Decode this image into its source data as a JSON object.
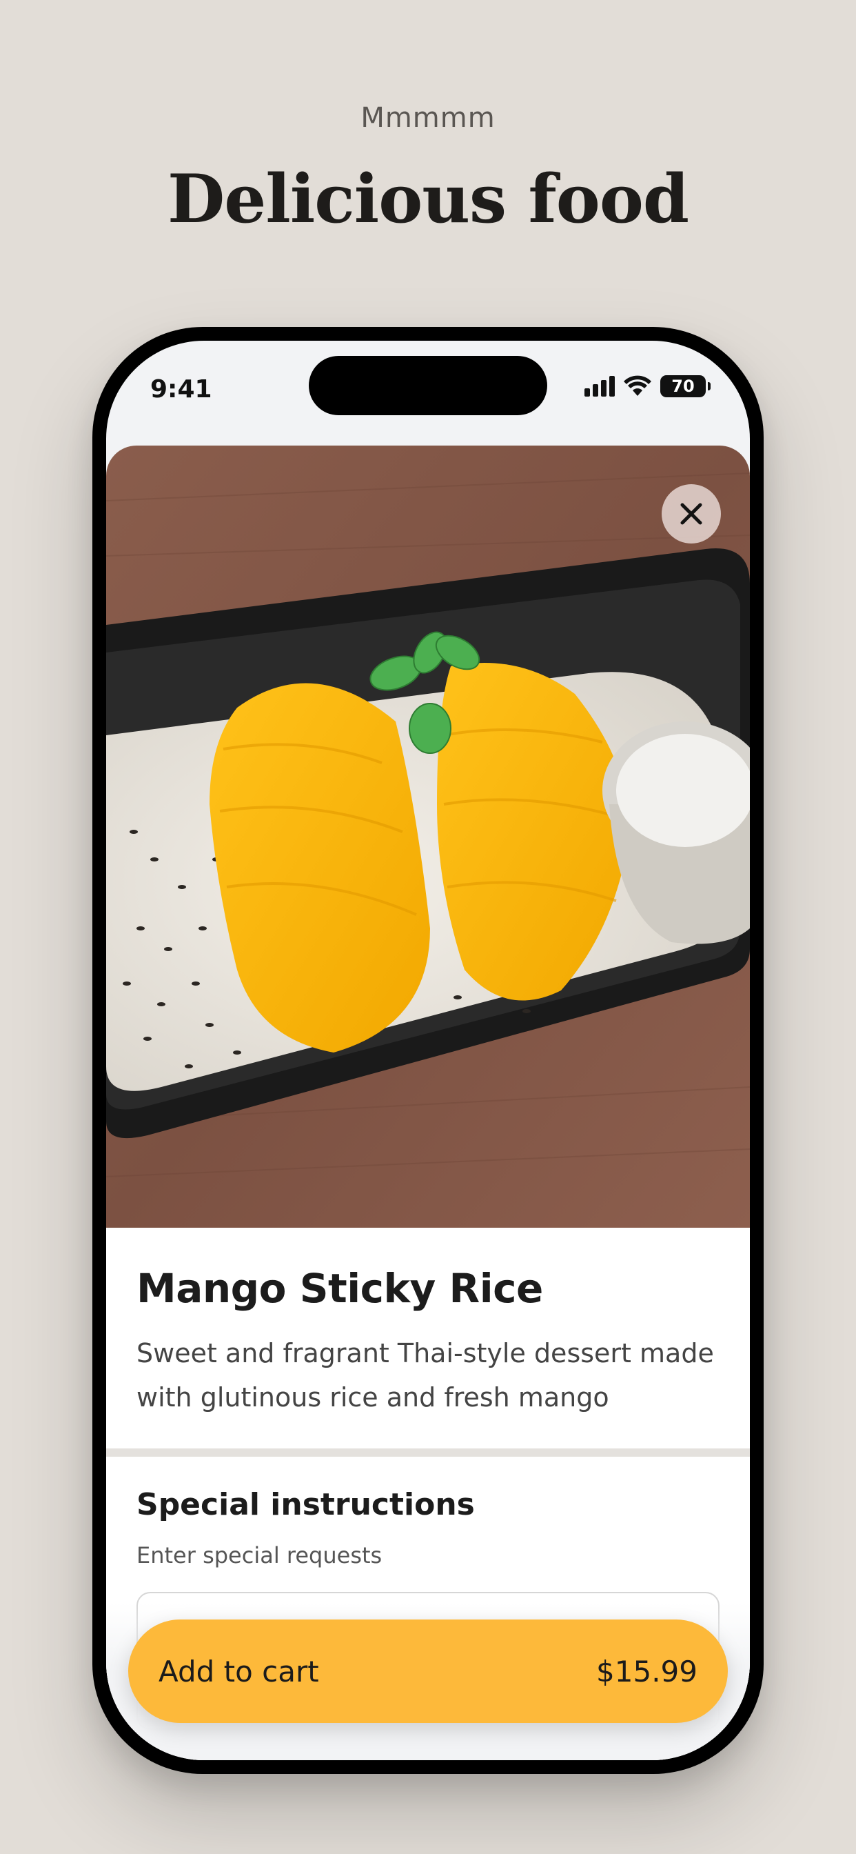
{
  "header": {
    "eyebrow": "Mmmmm",
    "headline": "Delicious food"
  },
  "status_bar": {
    "time": "9:41",
    "battery": "70",
    "icons": [
      "signal-icon",
      "wifi-icon",
      "battery-icon"
    ]
  },
  "item": {
    "image_icon": "mango-sticky-rice-photo",
    "title": "Mango Sticky Rice",
    "description": "Sweet and fragrant Thai-style dessert made with glutinous rice and fresh mango"
  },
  "instructions": {
    "title": "Special instructions",
    "subtitle": "Enter special requests",
    "value": ""
  },
  "cart": {
    "label": "Add to cart",
    "price": "$15.99"
  },
  "colors": {
    "background": "#e2ddd7",
    "accent": "#fdb93a",
    "text": "#1c1c1c"
  }
}
